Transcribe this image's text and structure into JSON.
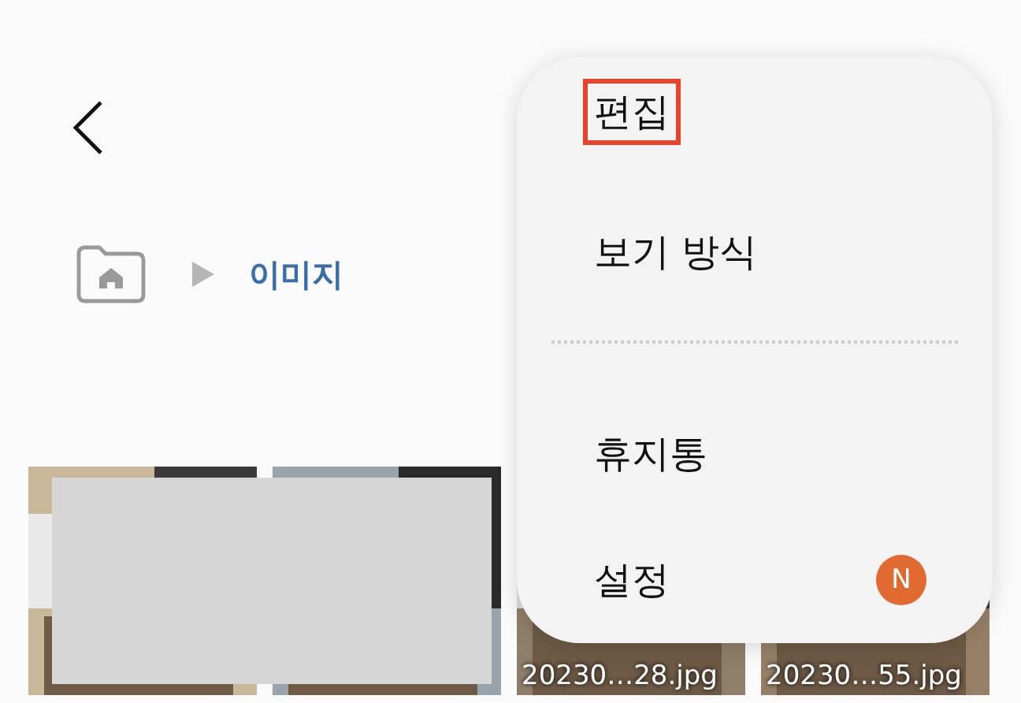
{
  "breadcrumb": {
    "current": "이미지"
  },
  "thumbnails": [
    {
      "kind": "picture"
    },
    {
      "kind": "picture"
    },
    {
      "kind": "picture",
      "caption": "20230…28.jpg"
    },
    {
      "kind": "picture",
      "caption": "20230…55.jpg"
    }
  ],
  "menu": {
    "items": [
      {
        "label": "편집",
        "highlighted": true
      },
      {
        "label": "보기 방식",
        "highlighted": false,
        "divider_after": true
      },
      {
        "label": "휴지통",
        "highlighted": false
      },
      {
        "label": "설정",
        "highlighted": false,
        "badge": "N"
      }
    ]
  }
}
